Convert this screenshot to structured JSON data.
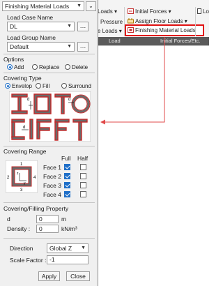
{
  "ribbon": {
    "loads_label": "Loads",
    "pressure_label": "Pressure",
    "loads2_label": "e Loads",
    "initial_forces_label": "Initial Forces",
    "assign_floor_loads_label": "Assign Floor Loads",
    "finishing_material_loads_label": "Finishing Material Loads",
    "lo_label": "Lo",
    "group_left": "Load",
    "group_right": "Initial Forces/Etc.",
    "highlight_color": "#e01010"
  },
  "panel": {
    "dropdown_value": "Finishing Material Loads",
    "load_case_name_label": "Load Case Name",
    "load_case_value": "DL",
    "load_group_name_label": "Load Group Name",
    "load_group_value": "Default",
    "options_label": "Options",
    "options": [
      "Add",
      "Replace",
      "Delete"
    ],
    "covering_type_label": "Covering Type",
    "covering_types": [
      "Envelop",
      "Fill",
      "Surround"
    ],
    "diagram_d_label": "d",
    "covering_range_label": "Covering Range",
    "full_label": "Full",
    "half_label": "Half",
    "faces": [
      "Face 1",
      "Face 2",
      "Face 3",
      "Face 4"
    ],
    "range_numbers": [
      "1",
      "2",
      "3",
      "4"
    ],
    "axis_z": "z",
    "axis_y": "y",
    "property_label": "Covering/Filling Property",
    "d_label": "d",
    "d_value": "0",
    "d_unit": "m",
    "density_label": "Density :",
    "density_value": "0",
    "density_unit": "kN/m³",
    "direction_label": "Direction",
    "direction_value": "Global Z",
    "scale_factor_label": "Scale Factor :",
    "scale_factor_value": "-1",
    "apply_label": "Apply",
    "close_label": "Close"
  }
}
